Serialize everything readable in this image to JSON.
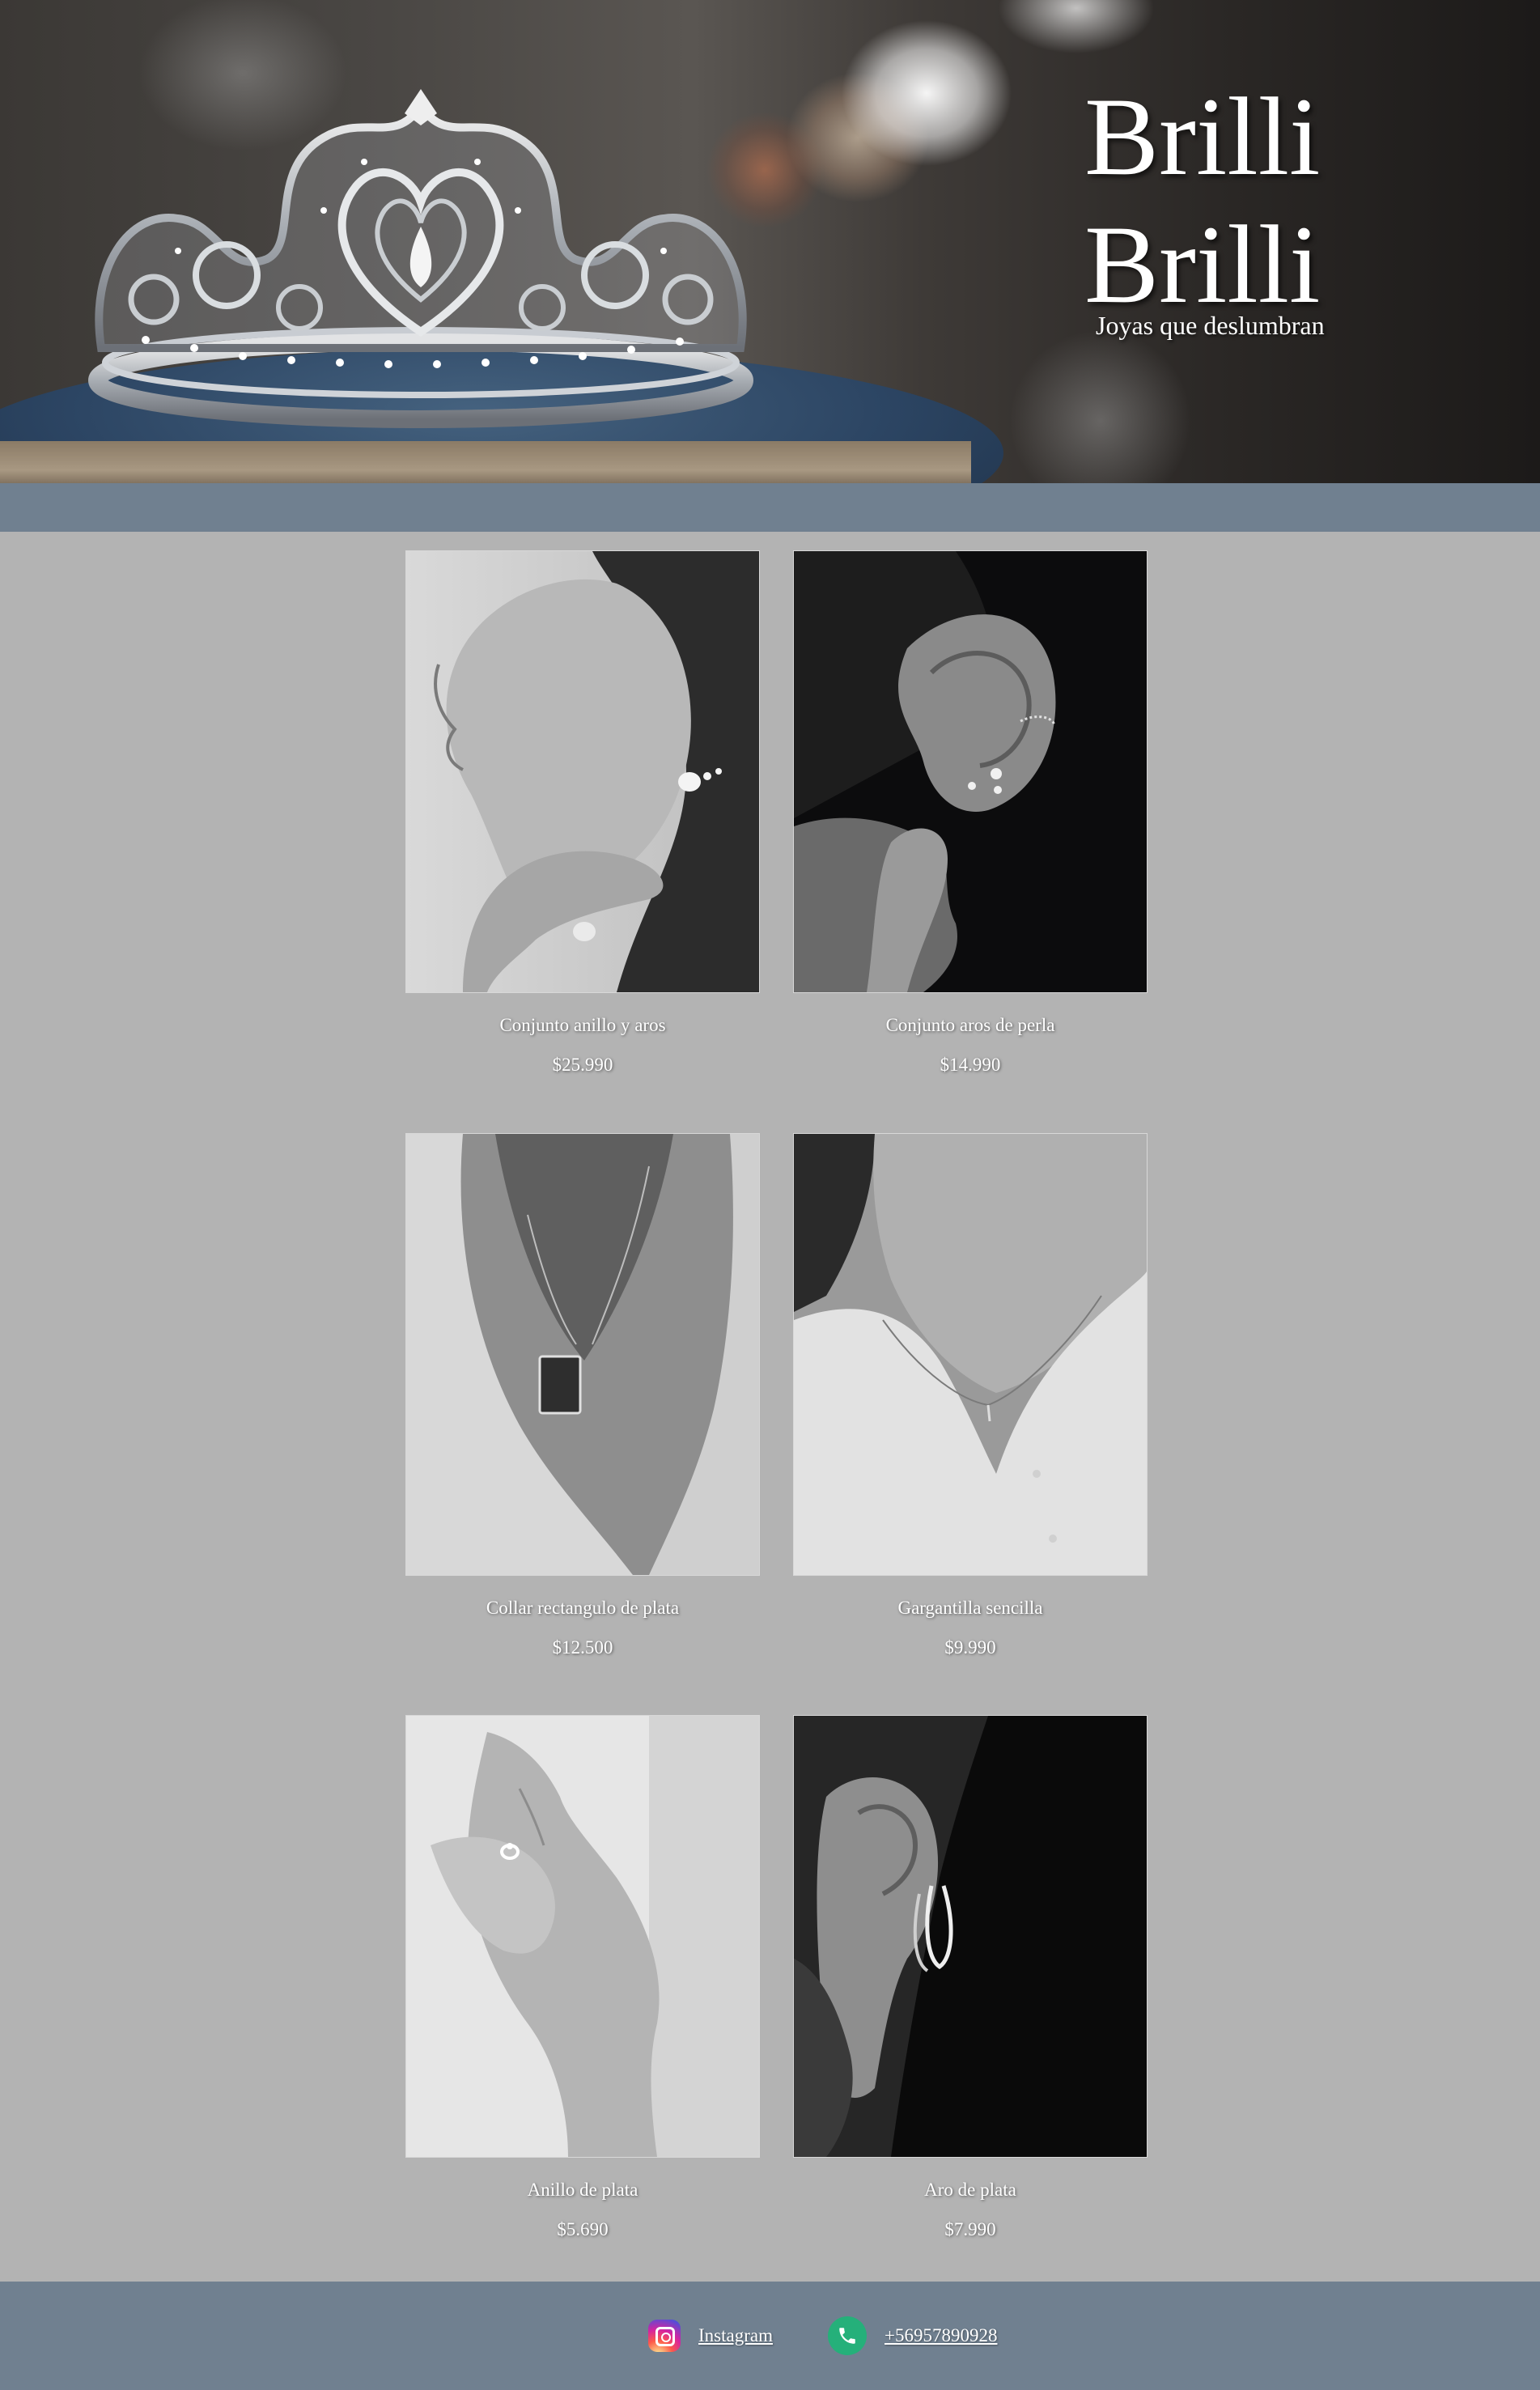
{
  "brand": {
    "title_line1": "Brilli",
    "title_line2": "Brilli",
    "tagline": "Joyas que deslumbran"
  },
  "hero": {
    "image_icon": "tiara-image"
  },
  "products": [
    {
      "name": "Conjunto anillo y aros",
      "price": "$25.990",
      "image_icon": "woman-profile-earrings-ring-photo"
    },
    {
      "name": "Conjunto aros de perla",
      "price": "$14.990",
      "image_icon": "ear-pearl-earrings-photo"
    },
    {
      "name": "Collar rectangulo de plata",
      "price": "$12.500",
      "image_icon": "rectangle-pendant-necklace-photo"
    },
    {
      "name": "Gargantilla sencilla",
      "price": "$9.990",
      "image_icon": "simple-choker-necklace-photo"
    },
    {
      "name": "Anillo de plata",
      "price": "$5.690",
      "image_icon": "silver-ring-hands-photo"
    },
    {
      "name": "Aro de plata",
      "price": "$7.990",
      "image_icon": "silver-hoop-earring-photo"
    }
  ],
  "footer": {
    "instagram_label": "Instagram",
    "phone_label": "+56957890928",
    "instagram_icon": "instagram-icon",
    "phone_icon": "whatsapp-phone-icon"
  },
  "colors": {
    "page_background": "#b3b3b3",
    "band_background": "#708090",
    "footer_background": "#708090",
    "text": "#ffffff",
    "phone_icon_green": "#25b07a"
  }
}
